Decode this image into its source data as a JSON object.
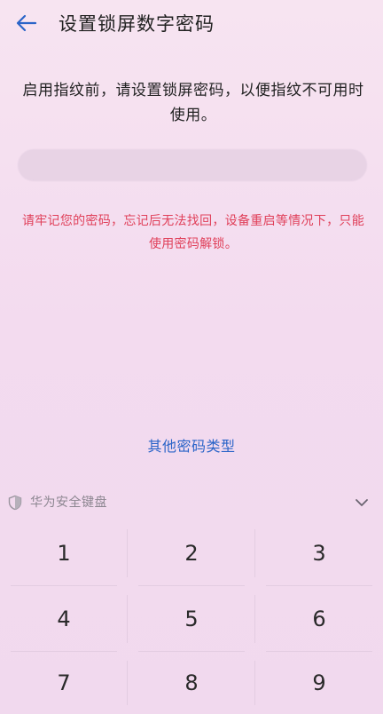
{
  "header": {
    "title": "设置锁屏数字密码",
    "back_icon": "arrow-left-icon"
  },
  "main": {
    "instruction": "启用指纹前，请设置锁屏密码，以便指纹不可用时使用。",
    "warning": "请牢记您的密码，忘记后无法找回，设备重启等情况下，只能使用密码解锁。",
    "other_types_link": "其他密码类型"
  },
  "keyboard": {
    "name": "华为安全键盘",
    "shield_icon": "shield-icon",
    "collapse_icon": "chevron-down-icon",
    "keys": [
      "1",
      "2",
      "3",
      "4",
      "5",
      "6",
      "7",
      "8",
      "9"
    ]
  },
  "colors": {
    "accent": "#2a64c8",
    "warning": "#e0405a",
    "background": "#f5dff0"
  }
}
